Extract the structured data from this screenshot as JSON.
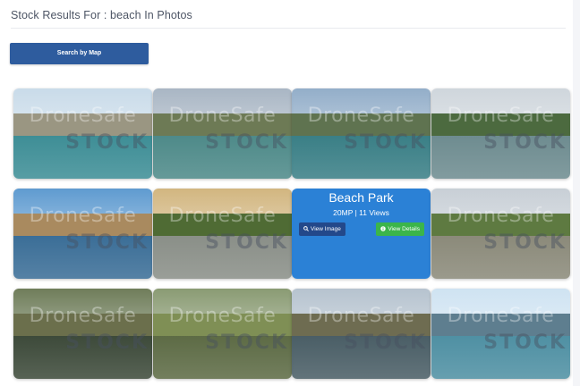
{
  "page": {
    "title": "Stock Results For : beach In Photos"
  },
  "toolbar": {
    "map_button_label": "Search by Map"
  },
  "watermark": {
    "line1": "DroneSafe",
    "line2": "STOCK"
  },
  "hover": {
    "title": "Beach Park",
    "meta": "20MP | 11 Views",
    "view_image_label": "View Image",
    "view_details_label": "View Details"
  },
  "photos": [
    {
      "sky": "#c9dbe9",
      "land": "#9a9682",
      "sea": "#3e8e96"
    },
    {
      "sky": "#a9b6c4",
      "land": "#6d7a55",
      "sea": "#4e8a89"
    },
    {
      "sky": "#93aec9",
      "land": "#5f7350",
      "sea": "#3a7f86"
    },
    {
      "sky": "#cfd6dc",
      "land": "#4c6a3f",
      "sea": "#6e8c90"
    },
    {
      "sky": "#5f9bd0",
      "land": "#a98a5f",
      "sea": "#3b6e97"
    },
    {
      "sky": "#d2b680",
      "land": "#4f6b34",
      "sea": "#8a8f88"
    },
    {
      "sky": "#1976d2",
      "land": "#1976d2",
      "sea": "#1976d2"
    },
    {
      "sky": "#c8cfd6",
      "land": "#5e7a41",
      "sea": "#8b8a7a"
    },
    {
      "sky": "#6f7d5a",
      "land": "#6b6f4c",
      "sea": "#3d4a3a"
    },
    {
      "sky": "#8a9b73",
      "land": "#7f8f55",
      "sea": "#5d6b45"
    },
    {
      "sky": "#b6c3cf",
      "land": "#6e6c51",
      "sea": "#4a5e66"
    },
    {
      "sky": "#cfe3f2",
      "land": "#5e7e8f",
      "sea": "#4f90a3"
    }
  ]
}
